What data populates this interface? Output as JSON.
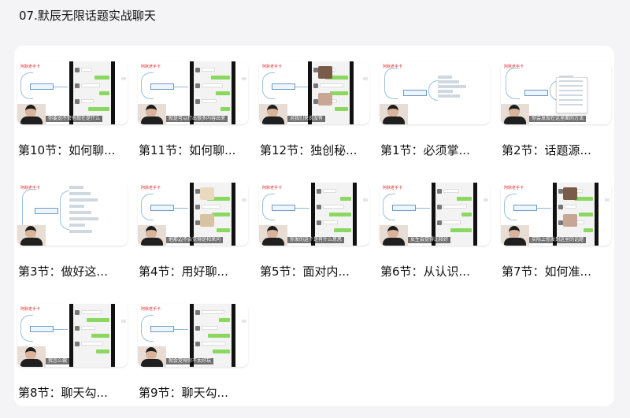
{
  "page": {
    "title": "07.默辰无限话题实战聊天"
  },
  "lessons": [
    {
      "title": "第10节：如何聊...",
      "subtitle": "你要说不管他现在是什么",
      "theme": "chat"
    },
    {
      "title": "第11节：如何聊...",
      "subtitle": "就是可以打出很多内容出来",
      "theme": "chat"
    },
    {
      "title": "第12节：独创秘...",
      "subtitle": "对我们来说没有",
      "theme": "photo"
    },
    {
      "title": "第1节：必须掌...",
      "subtitle": "",
      "theme": "mindmap"
    },
    {
      "title": "第2节：话题源...",
      "subtitle": "你会发现在这里面的方法",
      "theme": "menu"
    },
    {
      "title": "第3节：做好这...",
      "subtitle": "",
      "theme": "mindmap-big"
    },
    {
      "title": "第4节：用好聊...",
      "subtitle": "他那边不会觉得是和来问",
      "theme": "pet"
    },
    {
      "title": "第5节：面对内...",
      "subtitle": "你发的这个是有什么意思",
      "theme": "chat-title"
    },
    {
      "title": "第6节：从认识...",
      "subtitle": "女生会觉得比较好",
      "theme": "chat"
    },
    {
      "title": "第7节：如何准...",
      "subtitle": "实际上你发到这里的话题",
      "theme": "chat-photo"
    },
    {
      "title": "第8节：聊天勾...",
      "subtitle": "我怎么做",
      "theme": "chat"
    },
    {
      "title": "第9节：聊天勾...",
      "subtitle": "就会觉得你不太好玩",
      "theme": "chat"
    }
  ],
  "thumb": {
    "logo_text": "阿默老手卡"
  }
}
